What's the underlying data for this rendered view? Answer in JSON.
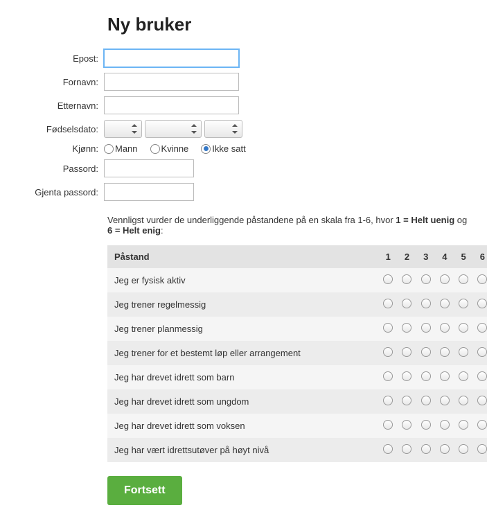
{
  "title": "Ny bruker",
  "form": {
    "email_label": "Epost:",
    "firstname_label": "Fornavn:",
    "lastname_label": "Etternavn:",
    "birthdate_label": "Fødselsdato:",
    "gender_label": "Kjønn:",
    "password_label": "Passord:",
    "repeat_password_label": "Gjenta passord:",
    "email_value": "",
    "firstname_value": "",
    "lastname_value": "",
    "password_value": "",
    "repeat_password_value": "",
    "gender_options": {
      "male": "Mann",
      "female": "Kvinne",
      "unset": "Ikke satt"
    },
    "gender_selected": "unset"
  },
  "survey": {
    "instructions_prefix": "Vennligst vurder de underliggende påstandene på en skala fra 1-6, hvor ",
    "instructions_one": "1 = Helt uenig",
    "instructions_mid": " og ",
    "instructions_six": "6 = Helt enig",
    "instructions_suffix": ":",
    "header_statement": "Påstand",
    "scale": [
      "1",
      "2",
      "3",
      "4",
      "5",
      "6"
    ],
    "statements": [
      "Jeg er fysisk aktiv",
      "Jeg trener regelmessig",
      "Jeg trener planmessig",
      "Jeg trener for et bestemt løp eller arrangement",
      "Jeg har drevet idrett som barn",
      "Jeg har drevet idrett som ungdom",
      "Jeg har drevet idrett som voksen",
      "Jeg har vært idrettsutøver på høyt nivå"
    ]
  },
  "continue_label": "Fortsett"
}
